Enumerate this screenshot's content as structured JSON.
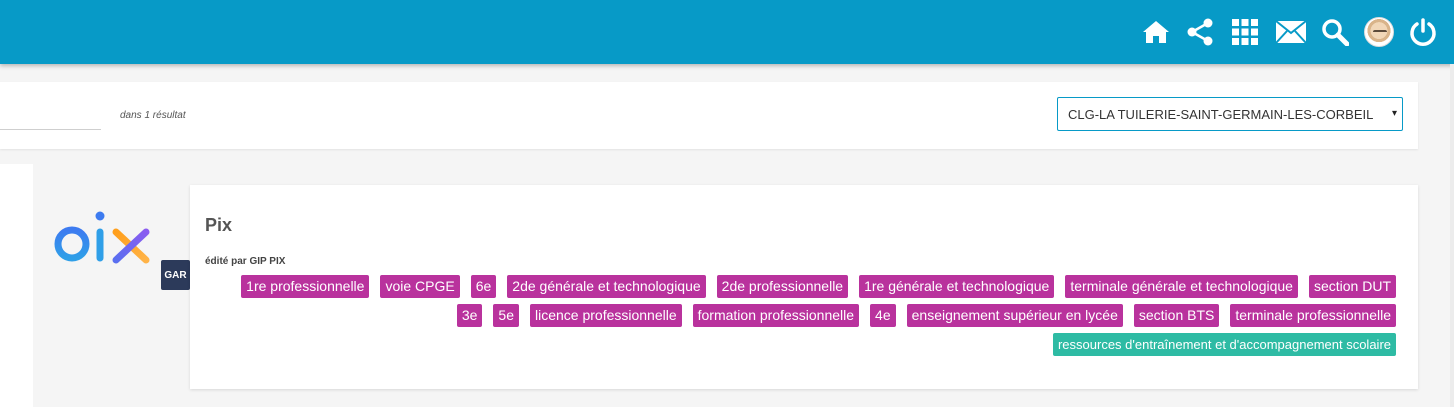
{
  "topbar": {
    "icons": [
      "home-icon",
      "share-icon",
      "apps-grid-icon",
      "mail-icon",
      "search-icon",
      "avatar",
      "power-icon"
    ],
    "color": "#079ac7"
  },
  "search": {
    "result_count": "dans 1 résultat",
    "establishment": "CLG-LA TUILERIE-SAINT-GERMAIN-LES-CORBEIL",
    "caret": "▾"
  },
  "resource": {
    "badge": "GAR",
    "title": "Pix",
    "editor": "édité par GIP PIX",
    "tag_rows": [
      [
        "1re professionnelle",
        "voie CPGE",
        "6e",
        "2de générale et technologique",
        "2de professionnelle",
        "1re générale et technologique",
        "terminale générale et technologique",
        "section DUT"
      ],
      [
        "3e",
        "5e",
        "licence professionnelle",
        "formation professionnelle",
        "4e",
        "enseignement supérieur en lycée",
        "section BTS",
        "terminale professionnelle"
      ]
    ],
    "category_tag": "ressources d'entraînement et d'accompagnement scolaire",
    "colors": {
      "level_tag": "#b9329d",
      "category_tag": "#2ebba4"
    }
  }
}
